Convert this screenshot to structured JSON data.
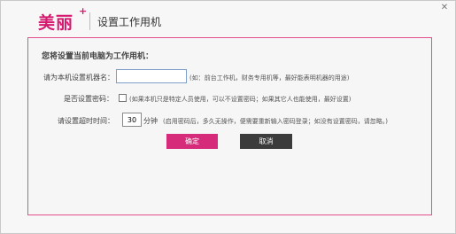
{
  "window": {
    "brand": "美丽",
    "brand_plus": "+",
    "title": "设置工作用机",
    "close_symbol": "✕"
  },
  "form": {
    "heading": "您将设置当前电脑为工作用机：",
    "machine_name_label": "请为本机设置机器名：",
    "machine_name_value": "",
    "machine_name_hint": "(如：前台工作机，财务专用机等，最好能表明机器的用途)",
    "password_label": "是否设置密码：",
    "password_checked": false,
    "password_hint": "(如果本机只是特定人员使用，可以不设置密码；如果其它人也能使用，最好设置)",
    "timeout_label": "请设置超时时间：",
    "timeout_value": "30",
    "timeout_unit": "分钟",
    "timeout_hint": "(启用密码后，多久无操作，便需要重新输入密码登录；如没有设置密码，请忽略。)",
    "ok_label": "确定",
    "cancel_label": "取消"
  },
  "colors": {
    "brand": "#d4196f",
    "panel_border": "#e24f8c",
    "ok_button": "#d62a7a",
    "cancel_button": "#3b3b3b"
  }
}
